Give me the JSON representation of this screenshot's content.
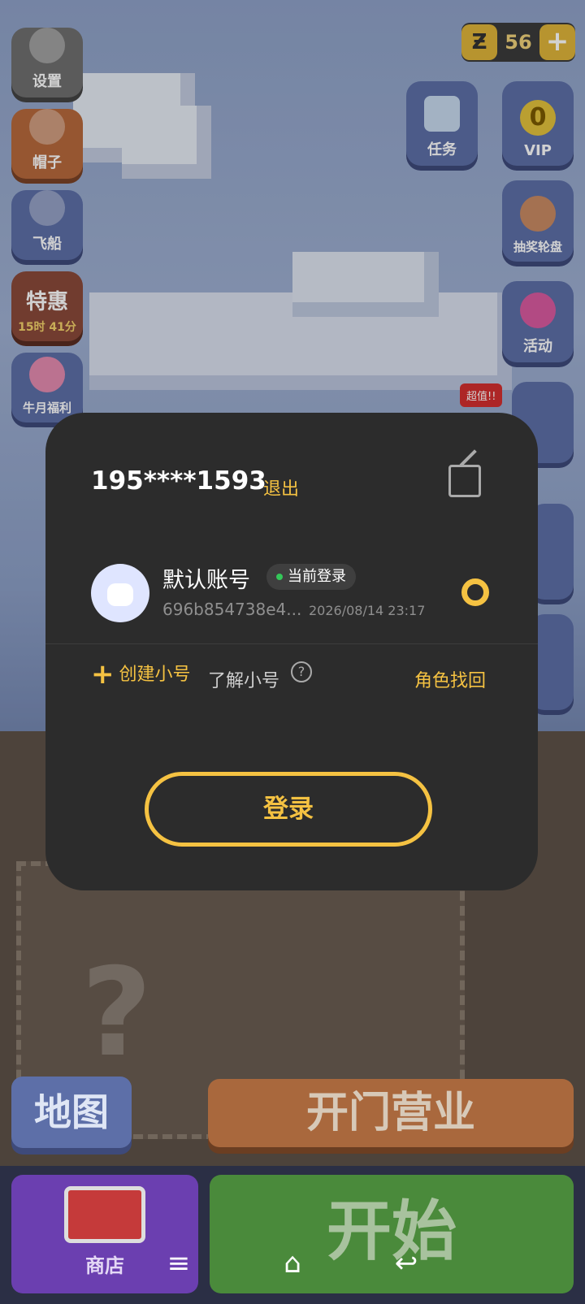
{
  "hud": {
    "coin_icon": "Ƶ",
    "coin_value": "56",
    "add_label": "+"
  },
  "left_menu": [
    {
      "label": "设置",
      "icon": "gear-icon"
    },
    {
      "label": "帽子",
      "icon": "hat-icon"
    },
    {
      "label": "飞船",
      "icon": "airship-icon"
    },
    {
      "label": "特惠",
      "sub": "15时 41分",
      "icon": "sale-icon"
    },
    {
      "label": "牛月福利",
      "icon": "flower-icon"
    }
  ],
  "right_menu": [
    {
      "label": "任务",
      "icon": "task-icon"
    },
    {
      "label": "VIP",
      "value": "0",
      "icon": "vip-icon"
    },
    {
      "label": "抽奖轮盘",
      "icon": "wheel-icon"
    },
    {
      "label": "活动",
      "icon": "gift-icon"
    }
  ],
  "badge_label": "超值!!",
  "dialog": {
    "account": "195****1593",
    "logout": "退出",
    "profile_name": "默认账号",
    "current_badge": "当前登录",
    "uid": "696b854738e4...",
    "timestamp": "2026/08/14 23:17",
    "create": "创建小号",
    "learn": "了解小号",
    "help": "?",
    "recover": "角色找回",
    "login": "登录"
  },
  "bottom": {
    "map": "地图",
    "open": "开门营业",
    "shop": "商店",
    "start": "开始"
  },
  "nav": {
    "menu": "≡",
    "home": "⌂",
    "back": "↩"
  }
}
